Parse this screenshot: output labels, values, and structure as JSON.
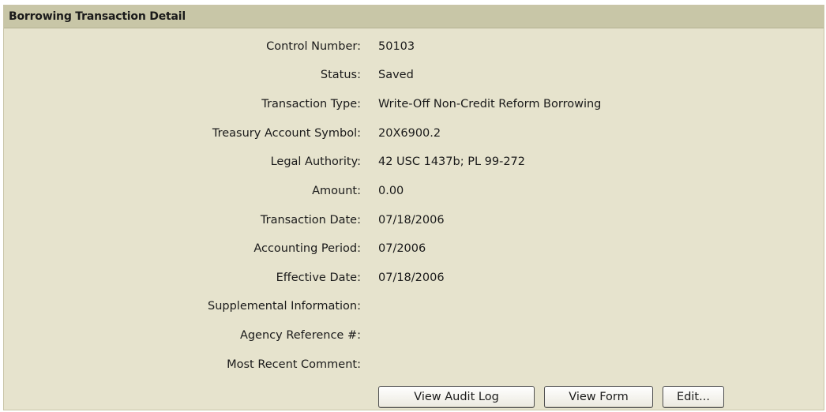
{
  "panel": {
    "title": "Borrowing Transaction Detail"
  },
  "fields": [
    {
      "label": "Control Number:",
      "value": "50103"
    },
    {
      "label": "Status:",
      "value": "Saved"
    },
    {
      "label": "Transaction Type:",
      "value": "Write-Off Non-Credit Reform Borrowing"
    },
    {
      "label": "Treasury Account Symbol:",
      "value": "20X6900.2"
    },
    {
      "label": "Legal Authority:",
      "value": "42 USC 1437b; PL 99-272"
    },
    {
      "label": "Amount:",
      "value": "0.00"
    },
    {
      "label": "Transaction Date:",
      "value": "07/18/2006"
    },
    {
      "label": "Accounting Period:",
      "value": "07/2006"
    },
    {
      "label": "Effective Date:",
      "value": "07/18/2006"
    },
    {
      "label": "Supplemental Information:",
      "value": ""
    },
    {
      "label": "Agency Reference #:",
      "value": ""
    },
    {
      "label": "Most Recent Comment:",
      "value": ""
    }
  ],
  "buttons": {
    "view_audit_log": "View Audit Log",
    "view_form": "View Form",
    "edit": "Edit..."
  }
}
